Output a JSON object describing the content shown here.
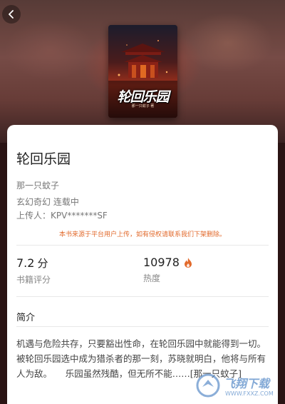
{
  "header": {
    "back_icon": "chevron-left-icon"
  },
  "cover": {
    "title": "轮回乐园",
    "subtitle": "那一只蚊子 著"
  },
  "book": {
    "title": "轮回乐园",
    "author": "那一只蚊子",
    "genre_status": "玄幻奇幻 连载中",
    "uploader": "上传人：KPV*******SF",
    "notice": "本书来源于平台用户上传，如有侵权请联系我们下架删除。"
  },
  "stats": {
    "rating_value": "7.2",
    "rating_unit": "分",
    "rating_label": "书籍评分",
    "heat_value": "10978",
    "heat_label": "热度",
    "heat_icon": "fire-icon",
    "accent_color": "#e26a2c"
  },
  "synopsis": {
    "title": "简介",
    "text": "机遇与危险共存，只要豁出性命，在轮回乐园中就能得到一切。　　被轮回乐园选中成为猎杀者的那一刻，苏晓就明白，他将与所有人为敌。　　乐园虽然残酷，但无所不能……[那一只蚊子]"
  },
  "watermark": {
    "text": "飞翔下载",
    "url": "WWW.FXXZ.COM"
  }
}
